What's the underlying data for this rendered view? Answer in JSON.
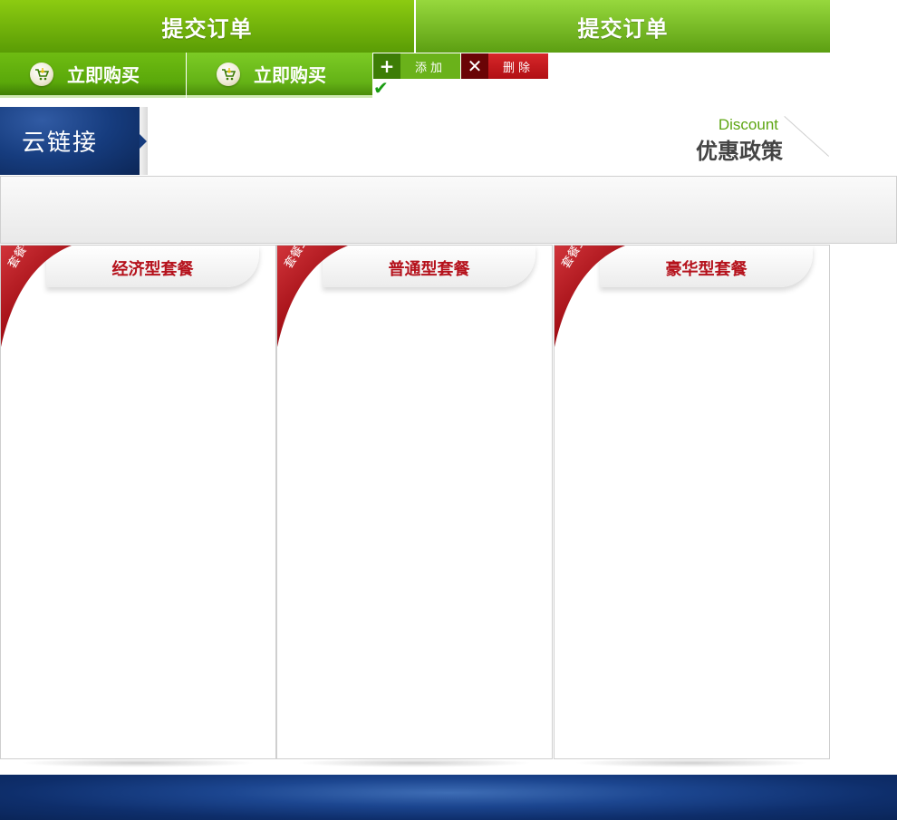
{
  "buttons": {
    "submit_order_1": "提交订单",
    "submit_order_2": "提交订单",
    "buy_now_1": "立即购买",
    "buy_now_2": "立即购买",
    "add": "添加",
    "delete": "删除"
  },
  "section": {
    "title": "云链接",
    "discount_en": "Discount",
    "discount_cn": "优惠政策"
  },
  "packages": [
    {
      "ribbon": "套餐一",
      "name": "经济型套餐"
    },
    {
      "ribbon": "套餐二",
      "name": "普通型套餐"
    },
    {
      "ribbon": "套餐三",
      "name": "豪华型套餐"
    }
  ],
  "colors": {
    "green": "#6ab21a",
    "red": "#b10f14",
    "navy": "#163c7e",
    "package_title": "#b5111b"
  },
  "icons": {
    "add": "plus-icon",
    "delete": "close-icon",
    "cart": "cart-icon",
    "check": "check-icon"
  }
}
